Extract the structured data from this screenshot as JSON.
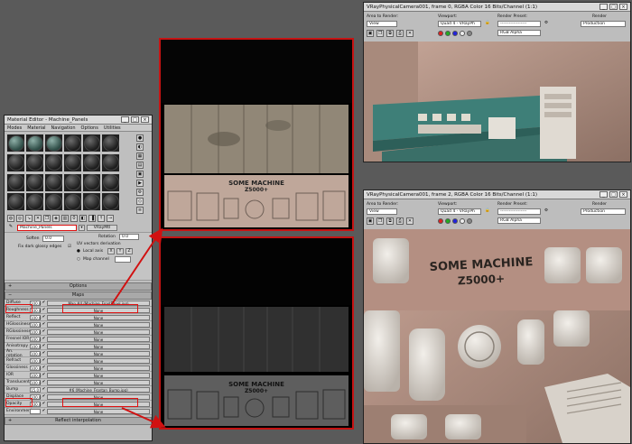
{
  "material_editor": {
    "title": "Material Editor - Machine_Panels",
    "menu": [
      "Modes",
      "Material",
      "Navigation",
      "Options",
      "Utilities"
    ],
    "material_name": "Machine_Panels",
    "material_type": "VRayMtl",
    "soften_label": "Soften",
    "soften_value": "0.0",
    "fix_label": "Fix dark glossy edges",
    "rotation_label": "Rotation",
    "rotation_value": "0.0",
    "uv_label": "UV vectors derivation",
    "local_axis": "Local axis",
    "axes": [
      "X",
      "Y",
      "Z"
    ],
    "map_channel": "Map channel",
    "options_title": "Options",
    "maps_title": "Maps",
    "reflect_interp": "Reflect interpolation",
    "maps": [
      {
        "label": "Diffuse",
        "amount": "100.0",
        "map": "Map #4 (Machine_FrontPanel.jpg)"
      },
      {
        "label": "Roughness",
        "amount": "100.0",
        "map": "None"
      },
      {
        "label": "Reflect",
        "amount": "100.0",
        "map": "None"
      },
      {
        "label": "HGlossiness",
        "amount": "100.0",
        "map": "None"
      },
      {
        "label": "RGlossiness",
        "amount": "100.0",
        "map": "None"
      },
      {
        "label": "Fresnel IOR",
        "amount": "100.0",
        "map": "None"
      },
      {
        "label": "Anisotropy",
        "amount": "100.0",
        "map": "None"
      },
      {
        "label": "An. rotation",
        "amount": "100.0",
        "map": "None"
      },
      {
        "label": "Refract",
        "amount": "100.0",
        "map": "None"
      },
      {
        "label": "Glossiness",
        "amount": "100.0",
        "map": "None"
      },
      {
        "label": "IOR",
        "amount": "100.0",
        "map": "None"
      },
      {
        "label": "Translucent",
        "amount": "100.0",
        "map": "None"
      },
      {
        "label": "Bump",
        "amount": "15.0",
        "map": "#6 (Machine_Frontan_Bump.jpg)"
      },
      {
        "label": "Displace",
        "amount": "100.0",
        "map": "None"
      },
      {
        "label": "Opacity",
        "amount": "100.0",
        "map": "None"
      },
      {
        "label": "Environment",
        "amount": "",
        "map": "None"
      }
    ]
  },
  "textures": {
    "top_text_1": "SOME MACHINE",
    "top_text_2": "Z5000+",
    "bottom_text_1": "SOME MACHINE",
    "bottom_text_2": "Z5000+"
  },
  "frame1": {
    "title": "VRayPhysicalCamera001, frame 0, RGBA Color 16 Bits/Channel (1:1)",
    "area_label": "Area to Render:",
    "area_value": "View",
    "viewport_label": "Viewport:",
    "viewport_value": "Quad 4 - VRayPh",
    "preset_label": "Render Preset:",
    "preset_value": "------------------",
    "render_label": "Render",
    "render_value": "Production",
    "channel_value": "RGB Alpha"
  },
  "frame2": {
    "title": "VRayPhysicalCamera001, frame 2, RGBA Color 16 Bits/Channel (1:1)",
    "area_label": "Area to Render:",
    "area_value": "View",
    "viewport_label": "Viewport:",
    "viewport_value": "Quad 4 - VRayPh",
    "preset_label": "Render Preset:",
    "preset_value": "------------------",
    "render_label": "Render",
    "render_value": "Production",
    "channel_value": "RGB Alpha",
    "machine_text_1": "SOME MACHINE",
    "machine_text_2": "Z5000+"
  },
  "colors": {
    "highlight": "#d11111",
    "background": "#5a5a5a",
    "panel": "#bfbfbf"
  }
}
